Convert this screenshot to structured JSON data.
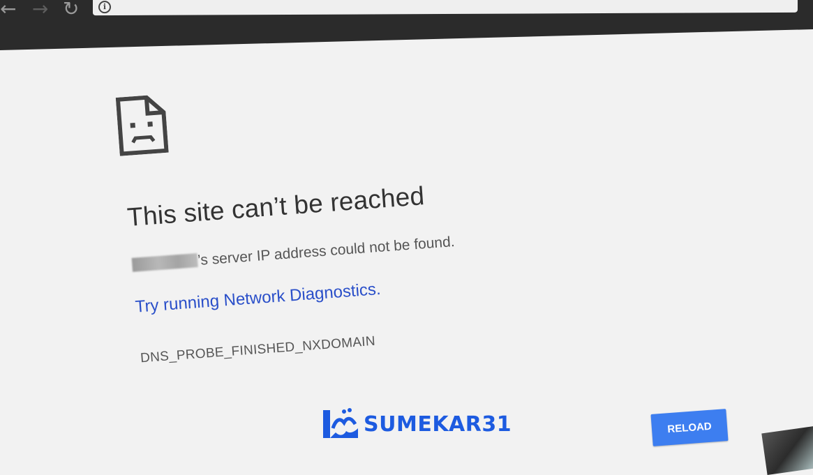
{
  "toolbar": {
    "back_icon": "arrow-left-icon",
    "forward_icon": "arrow-right-icon",
    "reload_icon": "reload-icon",
    "info_icon": "info-icon",
    "back_glyph": "←",
    "forward_glyph": "→",
    "reload_glyph": "↻",
    "info_glyph": "i"
  },
  "error": {
    "icon": "sad-document-icon",
    "title": "This site can’t be reached",
    "detail_suffix": "’s server IP address could not be found.",
    "diagnostics_link": "Try running Network Diagnostics.",
    "code": "DNS_PROBE_FINISHED_NXDOMAIN",
    "reload_label": "RELOAD"
  },
  "watermark": {
    "text": "SUMEKAR31",
    "color": "#1d5be0"
  },
  "colors": {
    "toolbar": "#2b2b2b",
    "page_bg": "#f2f2f2",
    "link": "#2a4fc9",
    "button": "#3d7ef0"
  }
}
